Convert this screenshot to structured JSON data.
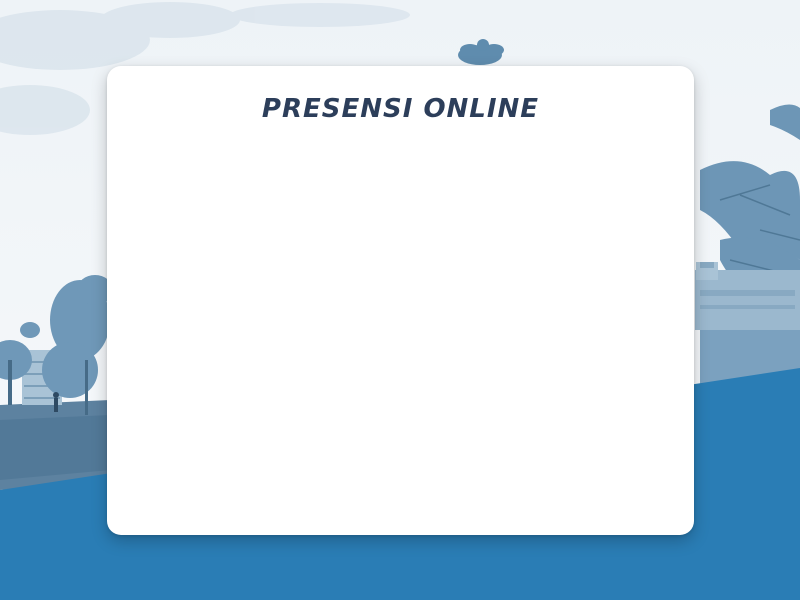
{
  "page": {
    "title": "PRESENSI ONLINE"
  },
  "colors": {
    "brand_blue": "#2a7db5",
    "title_color": "#2c3e5a",
    "photo_tint": "#7aa6c4",
    "card_bg": "#ffffff"
  },
  "background": {
    "icon": "campus-photo"
  }
}
